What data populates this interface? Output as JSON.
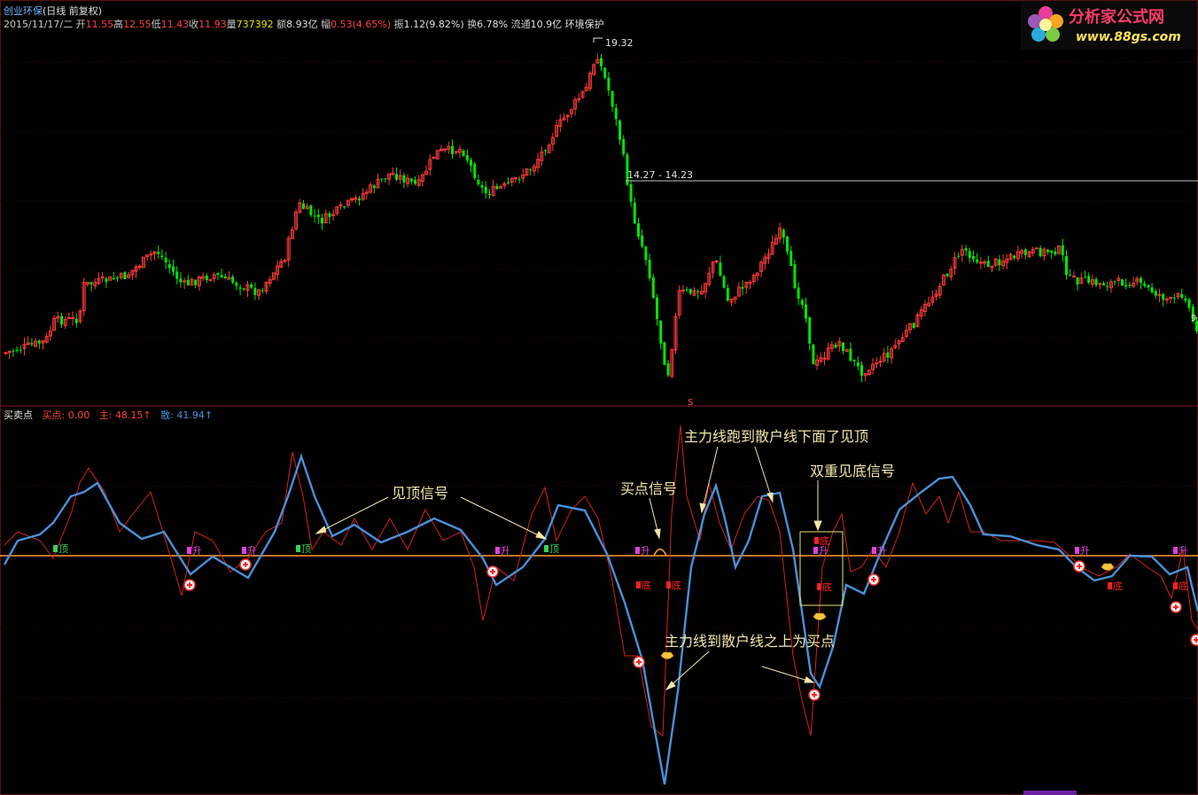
{
  "header": {
    "stock_name": "创业环保",
    "period_label": "(日线 前复权)",
    "date": "2015/11/17/二",
    "open_label": "开",
    "open": "11.55",
    "high_label": "高",
    "high": "12.55",
    "low_label": "低",
    "low": "11.43",
    "close_label": "收",
    "close": "11.93",
    "volume_label": "量",
    "volume": "737392",
    "amount_label": "额",
    "amount": "8.93亿",
    "change_label": "幅",
    "change": "0.53(4.65%)",
    "amplitude_label": "振",
    "amplitude": "1.12(9.82%)",
    "turnover_label": "换",
    "turnover": "6.78%",
    "float_label": "流通",
    "float": "10.9亿",
    "sector": "环境保护"
  },
  "price_panel": {
    "peak_label": "19.32",
    "hline_label": "14.27 - 14.23",
    "s_marker": "S",
    "right_edge_label": "9"
  },
  "indicator": {
    "name": "买卖点",
    "buy_label": "买点:",
    "buy_value": "0.00",
    "main_label": "主:",
    "main_value": "48.15↑",
    "retail_label": "散:",
    "retail_value": "41.94↑"
  },
  "annotations": {
    "top_signal": "见顶信号",
    "buy_signal": "买点信号",
    "main_below": "主力线跑到散户线下面了见顶",
    "double_bottom": "双重见底信号",
    "main_above": "主力线到散户线之上为买点"
  },
  "signals": {
    "top": "顶",
    "rise": "升",
    "bottom": "底"
  },
  "logo": {
    "title": "分析家公式网",
    "url": "www.88gs.com"
  },
  "colors": {
    "up": "#ff3a3a",
    "down": "#00e600",
    "main_line": "#4a90d9",
    "retail_line": "#d42020",
    "zero_line": "#ff9a30",
    "annotation": "#f3e6a8"
  }
}
